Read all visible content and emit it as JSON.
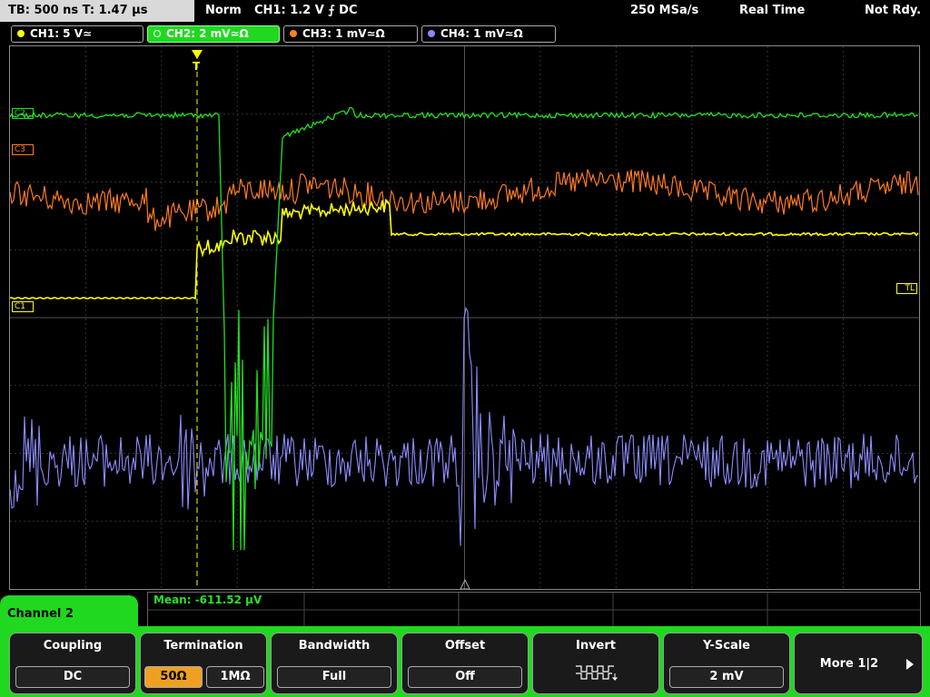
{
  "top_bar": {
    "timebase": "TB: 500 ns   T: 1.47 µs",
    "mode": "Norm",
    "trigger": "CH1: 1.2 V ⨍ DC",
    "sample_rate": "250 MSa/s",
    "acq_mode": "Real Time",
    "status": "Not Rdy."
  },
  "channel_tabs": [
    {
      "label": "CH1: 5 V≃",
      "color": "#ffff00"
    },
    {
      "label": "CH2: 2 mV≃Ω",
      "color": "#20d820"
    },
    {
      "label": "CH3: 1 mV≃Ω",
      "color": "#ff8020"
    },
    {
      "label": "CH4: 1 mV≃Ω",
      "color": "#8888ff"
    }
  ],
  "markers": {
    "c2": "C2",
    "c3": "C3",
    "c1": "C1",
    "trigger_level": "TL",
    "trigger_pos": "T"
  },
  "measurement": {
    "mean": "Mean: -611.52 µV"
  },
  "panel": {
    "channel": "Channel 2"
  },
  "softkeys": {
    "coupling": {
      "title": "Coupling",
      "value": "DC"
    },
    "termination": {
      "title": "Termination",
      "opt1": "50Ω",
      "opt2": "1MΩ"
    },
    "bandwidth": {
      "title": "Bandwidth",
      "value": "Full"
    },
    "offset": {
      "title": "Offset",
      "value": "Off"
    },
    "invert": {
      "title": "Invert"
    },
    "yscale": {
      "title": "Y-Scale",
      "value": "2 mV"
    },
    "more": {
      "title": "More 1|2"
    }
  }
}
